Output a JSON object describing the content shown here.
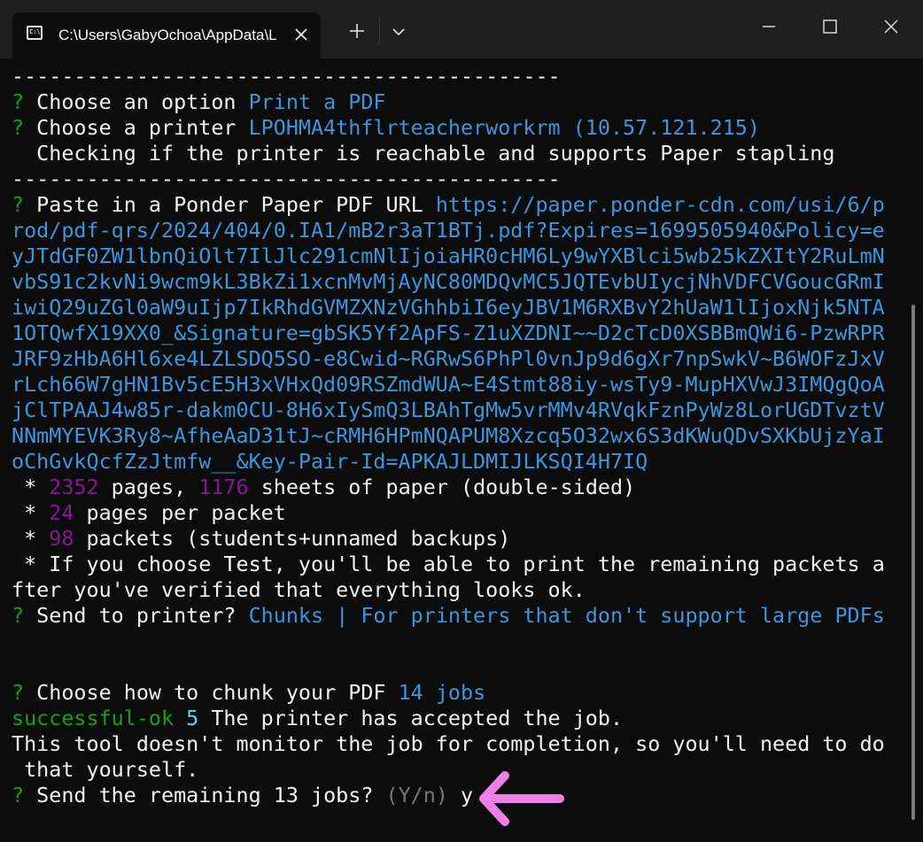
{
  "window": {
    "tab_title": "C:\\Users\\GabyOchoa\\AppData\\Local\\Microsoft\\WindowsApps\\",
    "tab_icon_text": "C:\\",
    "colors": {
      "background": "#0c0c0c",
      "titlebar": "#1f1f1f",
      "prompt_green": "#13a10e",
      "answer_blue": "#3a96dd",
      "number_purple": "#881798",
      "number_cyan": "#61d6d6",
      "hint_gray": "#767676",
      "arrow_pink": "#f07ee8"
    }
  },
  "terminal": {
    "sep1": "--------------------------------------------",
    "choose_option": {
      "mark": "?",
      "label": " Choose an option ",
      "value": "Print a PDF"
    },
    "choose_printer": {
      "mark": "?",
      "label": " Choose a printer ",
      "value": "LPOHMA4thflrteacherworkrm (10.57.121.215)"
    },
    "checking": "  Checking if the printer is reachable and supports Paper stapling",
    "sep2": "--------------------------------------------",
    "paste_url": {
      "mark": "?",
      "label": " Paste in a Ponder Paper PDF URL ",
      "lines": [
        "https://paper.ponder-cdn.com/usi/6/p",
        "rod/pdf-qrs/2024/404/0.IA1/mB2r3aT1BTj.pdf?Expires=1699505940&Policy=e",
        "yJTdGF0ZW1lbnQiOlt7IlJlc291cmNlIjoiaHR0cHM6Ly9wYXBlci5wb25kZXItY2RuLmN",
        "vbS91c2kvNi9wcm9kL3BkZi1xcnMvMjAyNC80MDQvMC5JQTEvbUIycjNhVDFCVGoucGRmI",
        "iwiQ29uZGl0aW9uIjp7IkRhdGVMZXNzVGhhbiI6eyJBV1M6RXBvY2hUaW1lIjoxNjk5NTA",
        "1OTQwfX19XX0_&Signature=gbSK5Yf2ApFS-Z1uXZDNI~~D2cTcD0XSBBmQWi6-PzwRPR",
        "JRF9zHbA6Hl6xe4LZLSDQ5SO-e8Cwid~RGRwS6PhPl0vnJp9d6gXr7npSwkV~B6WOFzJxV",
        "rLch66W7gHN1Bv5cE5H3xVHxQd09RSZmdWUA~E4Stmt88iy-wsTy9-MupHXVwJ3IMQgQoA",
        "jClTPAAJ4w85r-dakm0CU-8H6xIySmQ3LBAhTgMw5vrMMv4RVqkFznPyWz8LorUGDTvztV",
        "NNmMYEVK3Ry8~AfheAaD31tJ~cRMH6HPmNQAPUM8Xzcq5O32wx6S3dKWuQDvSXKbUjzYaI",
        "oChGvkQcfZzJtmfw__&Key-Pair-Id=APKAJLDMIJLKSQI4H7IQ"
      ]
    },
    "stats": {
      "bullet": " * ",
      "pages": "2352",
      "pages_text": " pages, ",
      "sheets": "1176",
      "sheets_text": " sheets of paper (double-sided)",
      "per_packet": "24",
      "per_packet_text": " pages per packet",
      "packets": "98",
      "packets_text": " packets (students+unnamed backups)",
      "test_pre": " * If you choose ",
      "test_word": "Test",
      "test_post": ", you'll be able to print the remaining packets a",
      "test_cont": "fter you've verified that everything looks ok."
    },
    "send_printer": {
      "mark": "?",
      "label": " Send to printer? ",
      "value": "Chunks | For printers that don't support large PDFs"
    },
    "chunk": {
      "mark": "?",
      "label": " Choose how to chunk your PDF ",
      "value": "14 jobs"
    },
    "result": {
      "status": "successful-ok",
      "code": " 5",
      "message": " The printer has accepted the job."
    },
    "note_1": "This tool doesn't monitor the job for completion, so you'll need to do",
    "note_2": " that yourself.",
    "remaining": {
      "mark": "?",
      "label": " Send the remaining 13 jobs? ",
      "hint": "(Y/n)",
      "answer": " y"
    }
  }
}
